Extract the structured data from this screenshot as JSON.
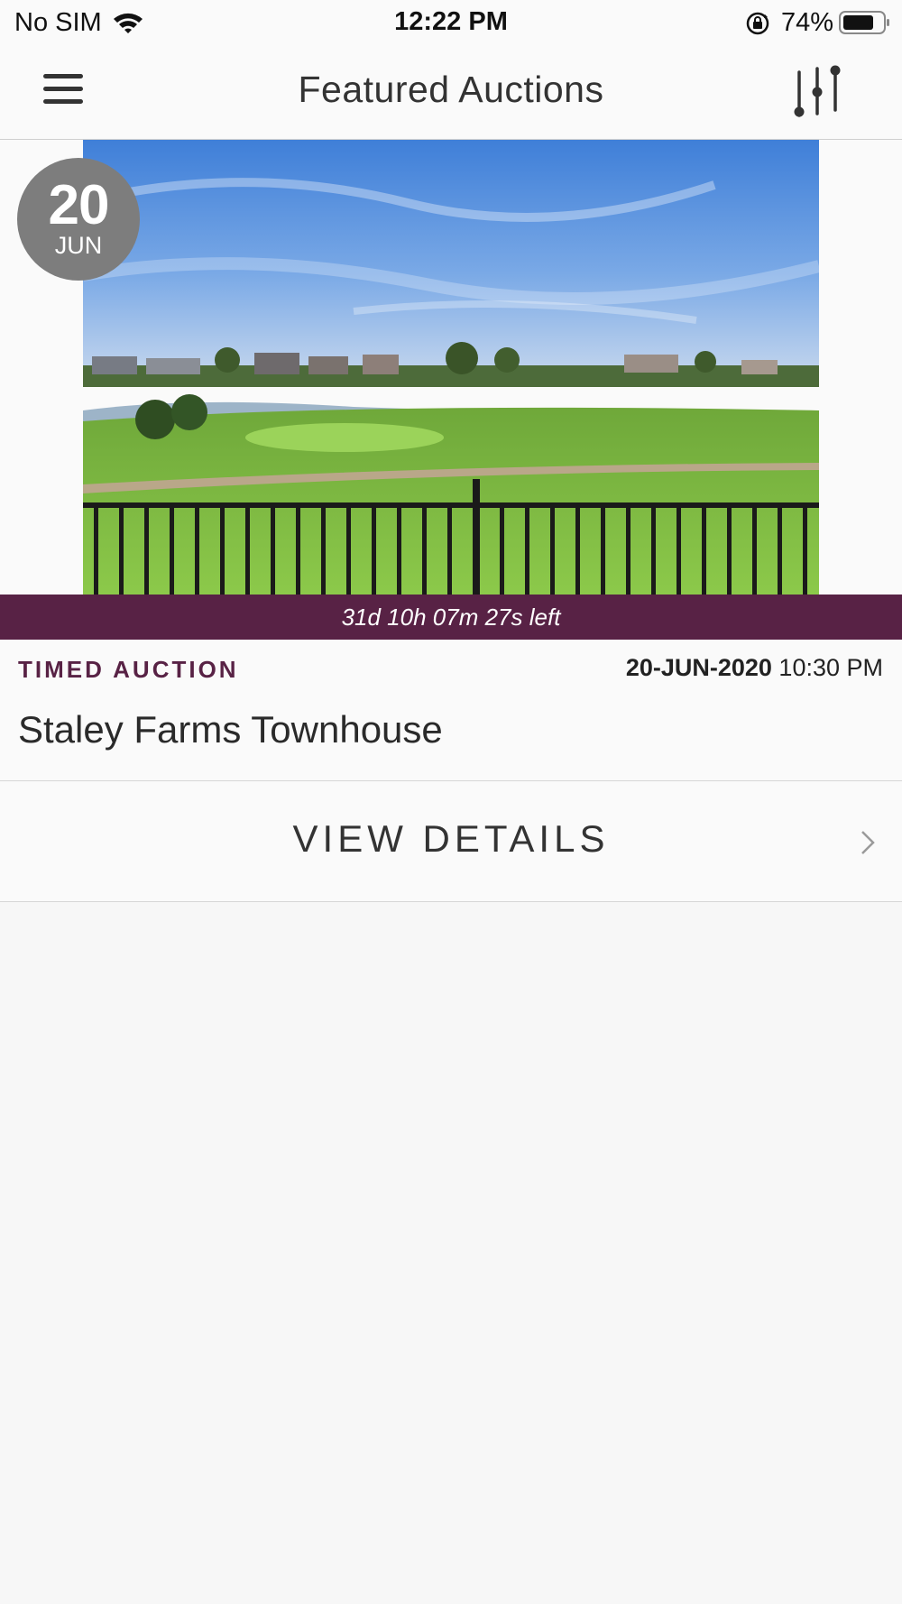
{
  "status_bar": {
    "carrier": "No SIM",
    "time": "12:22 PM",
    "battery_percent": "74%",
    "icons": [
      "wifi-icon",
      "rotation-lock-icon",
      "battery-icon"
    ]
  },
  "nav": {
    "title": "Featured Auctions",
    "menu_icon": "hamburger-menu-icon",
    "filter_icon": "filter-sliders-icon"
  },
  "auction": {
    "date_badge": {
      "day": "20",
      "month": "JUN"
    },
    "countdown": "31d 10h 07m 27s left",
    "type": "TIMED AUCTION",
    "date": "20-JUN-2020",
    "time": "10:30 PM",
    "title": "Staley Farms Townhouse",
    "view_details_label": "VIEW DETAILS",
    "photo_description_icon": "property-photo"
  },
  "colors": {
    "accent": "#582245",
    "badge": "#7d7d7d",
    "background": "#f8f8f8"
  }
}
